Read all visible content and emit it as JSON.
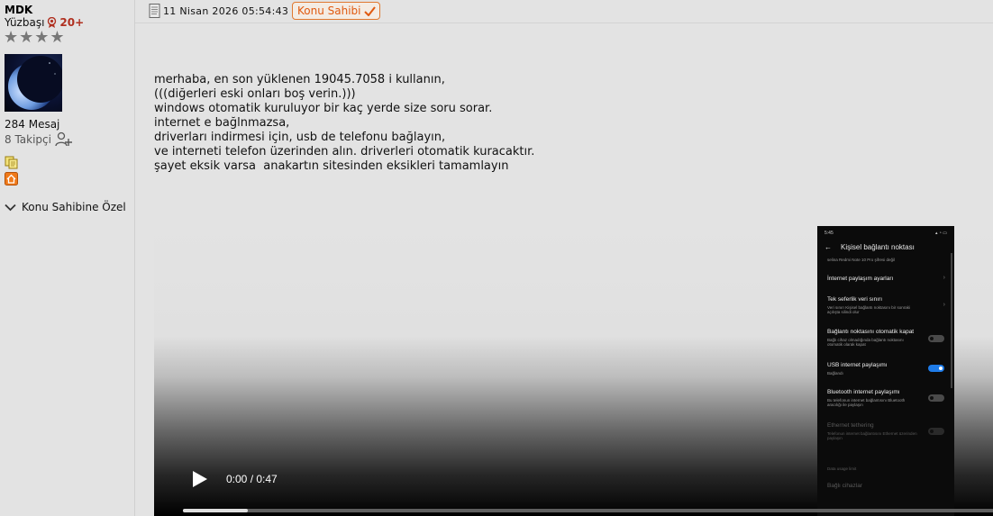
{
  "user": {
    "username": "MDK",
    "rank": "Yüzbaşı",
    "rank_count": "20+",
    "stars": 4,
    "message_count": "284 Mesaj",
    "followers": "8 Takipçi",
    "owner_special": "Konu Sahibine Özel"
  },
  "post": {
    "date": "11 Nisan 2026 05:54:43",
    "owner_badge": "Konu Sahibi",
    "body_lines": [
      "merhaba, en son yüklenen 19045.7058 i kullanın,",
      "(((diğerleri eski onları boş verin.)))",
      "windows otomatik kuruluyor bir kaç yerde size soru sorar.",
      "internet e bağlnmazsa,",
      "driverları indirmesi için, usb de telefonu bağlayın,",
      "ve interneti telefon üzerinden alın. driverleri otomatik kuracaktır.",
      "şayet eksik varsa  anakartın sitesinden eksikleri tamamlayın"
    ]
  },
  "video": {
    "time": "0:00 / 0:47",
    "progress": 0.08,
    "phone": {
      "status_time": "5:45",
      "header": "Kişisel bağlantı noktası",
      "top_sub": "selina Redmi Note 10 Pro şifresi değil",
      "options": [
        {
          "title": "İnternet paylaşım ayarları",
          "sub": ""
        },
        {
          "title": "Tek seferlik veri sınırı",
          "sub": "Veri sınırı Kişisel bağlantı noktasını bir sonraki açılışta silindi olur"
        },
        {
          "title": "Bağlantı noktasını otomatik kapat",
          "sub": "Bağlı cihaz olmadığında bağlantı noktasını otomatik olarak kapat"
        },
        {
          "title": "USB internet paylaşımı",
          "sub": "Bağlandı"
        },
        {
          "title": "Bluetooth internet paylaşımı",
          "sub": "Bu telefonun internet bağlantısını Bluetooth aracılığı ile paylaşın"
        },
        {
          "title": "Ethernet tethering",
          "sub": "Telefonun internet bağlantısını Ethernet üzerinden paylaşın"
        }
      ],
      "bottom_1": "Data usage limit",
      "bottom_2": "Bağlı cihazlar"
    }
  },
  "colors": {
    "rank_accent": "#b03020",
    "owner_badge": "#e07830",
    "toggle_on": "#1e7be8"
  }
}
